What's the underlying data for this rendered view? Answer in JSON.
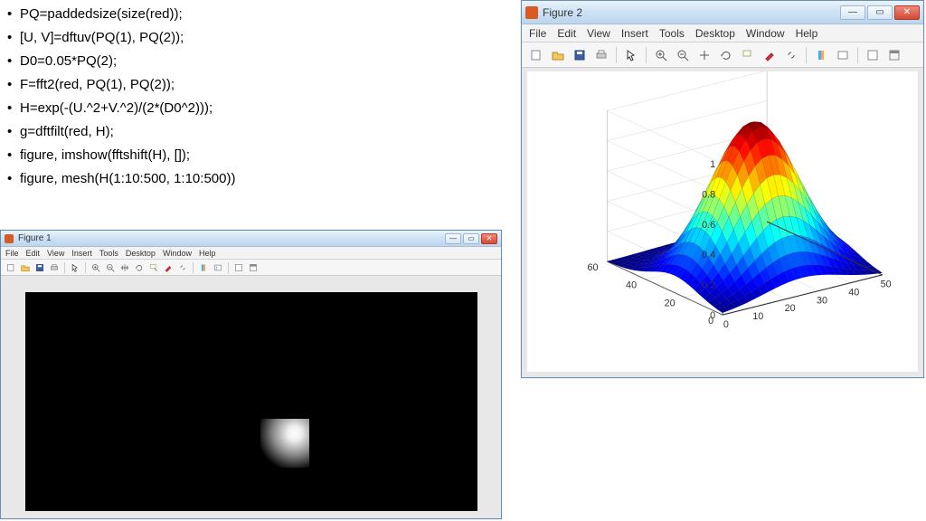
{
  "code": [
    "PQ=paddedsize(size(red));",
    "[U, V]=dftuv(PQ(1), PQ(2));",
    "D0=0.05*PQ(2);",
    "F=fft2(red, PQ(1), PQ(2));",
    "H=exp(-(U.^2+V.^2)/(2*(D0^2)));",
    "g=dftfilt(red, H);",
    "figure, imshow(fftshift(H), []);",
    "figure, mesh(H(1:10:500, 1:10:500))"
  ],
  "fig1": {
    "title": "Figure 1",
    "menus": [
      "File",
      "Edit",
      "View",
      "Insert",
      "Tools",
      "Desktop",
      "Window",
      "Help"
    ]
  },
  "fig2": {
    "title": "Figure 2",
    "menus": [
      "File",
      "Edit",
      "View",
      "Insert",
      "Tools",
      "Desktop",
      "Window",
      "Help"
    ]
  },
  "winctl": {
    "min": "—",
    "max": "▭",
    "close": "✕"
  },
  "chart_data": {
    "type": "surface",
    "title": "",
    "x_range": [
      0,
      50
    ],
    "y_range": [
      0,
      60
    ],
    "z_range": [
      0,
      1
    ],
    "x_ticks": [
      0,
      10,
      20,
      30,
      40,
      50
    ],
    "y_ticks": [
      0,
      20,
      40,
      60
    ],
    "z_ticks": [
      0,
      0.2,
      0.4,
      0.6,
      0.8,
      1
    ],
    "description": "2D Gaussian surface peaking near center ~1.0, decaying to ~0 at edges; colormap jet (blue low to red high).",
    "peak": {
      "x": 25,
      "y": 25,
      "z": 1.0
    }
  }
}
